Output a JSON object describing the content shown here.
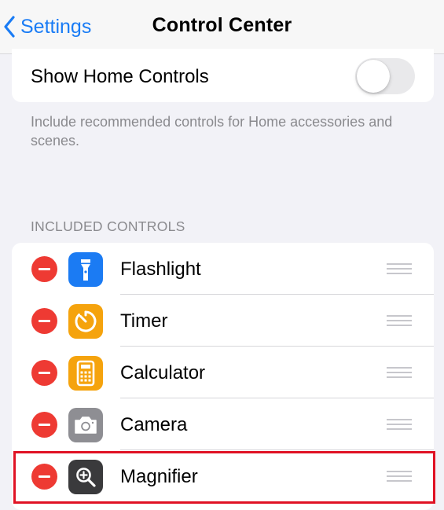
{
  "navbar": {
    "back_label": "Settings",
    "title": "Control Center"
  },
  "home": {
    "label": "Show Home Controls",
    "toggle_on": false,
    "footnote": "Include recommended controls for Home accessories and scenes."
  },
  "included": {
    "header": "INCLUDED CONTROLS",
    "items": [
      {
        "label": "Flashlight",
        "icon": "flashlight-icon",
        "icon_color": "#1b7bf3"
      },
      {
        "label": "Timer",
        "icon": "timer-icon",
        "icon_color": "#f5a30d"
      },
      {
        "label": "Calculator",
        "icon": "calculator-icon",
        "icon_color": "#f5a30d"
      },
      {
        "label": "Camera",
        "icon": "camera-icon",
        "icon_color": "#8e8e93"
      },
      {
        "label": "Magnifier",
        "icon": "magnifier-icon",
        "icon_color": "#3a3a3c"
      }
    ]
  },
  "colors": {
    "accent": "#1a7cf5",
    "remove": "#ee3a33",
    "highlight": "#e01224"
  }
}
